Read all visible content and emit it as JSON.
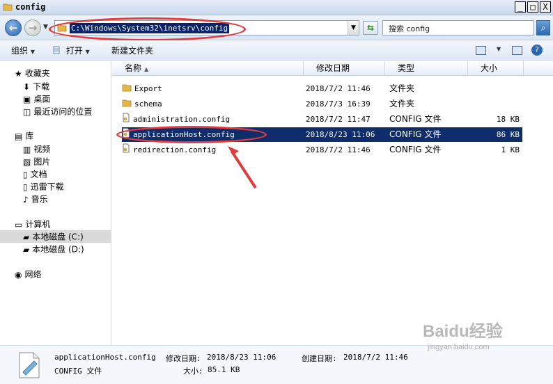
{
  "window": {
    "title": "config",
    "buttons": [
      "_",
      "□",
      "X"
    ]
  },
  "address_bar": {
    "path": "C:\\Windows\\System32\\inetsrv\\config",
    "search_placeholder": "搜索 config"
  },
  "toolbar": {
    "organize": "组织",
    "open": "打开",
    "new_folder": "新建文件夹"
  },
  "sidebar": {
    "favorites": "收藏夹",
    "favorites_items": [
      "下载",
      "桌面",
      "最近访问的位置"
    ],
    "libraries": "库",
    "library_items": [
      "视频",
      "图片",
      "文档",
      "迅雷下载",
      "音乐"
    ],
    "computer": "计算机",
    "computer_items": [
      "本地磁盘 (C:)",
      "本地磁盘 (D:)"
    ],
    "network": "网络"
  },
  "table": {
    "headers": [
      "名称",
      "修改日期",
      "类型",
      "大小"
    ],
    "rows": [
      {
        "name": "Export",
        "date": "2018/7/2 11:46",
        "type": "文件夹",
        "size": ""
      },
      {
        "name": "schema",
        "date": "2018/7/3 16:39",
        "type": "文件夹",
        "size": ""
      },
      {
        "name": "administration.config",
        "date": "2018/7/2 11:47",
        "type": "CONFIG 文件",
        "size": "18 KB"
      },
      {
        "name": "applicationHost.config",
        "date": "2018/8/23 11:06",
        "type": "CONFIG 文件",
        "size": "86 KB"
      },
      {
        "name": "redirection.config",
        "date": "2018/7/2 11:46",
        "type": "CONFIG 文件",
        "size": "1 KB"
      }
    ]
  },
  "details": {
    "filename": "applicationHost.config",
    "modified_label": "修改日期:",
    "modified_value": "2018/8/23 11:06",
    "created_label": "创建日期:",
    "created_value": "2018/7/2 11:46",
    "type": "CONFIG 文件",
    "size_label": "大小:",
    "size_value": "85.1 KB"
  },
  "watermark": {
    "brand": "Baidu经验",
    "url": "jingyan.baidu.com"
  },
  "colors": {
    "selection": "#0f2d6b",
    "annotation": "#e33b3b",
    "accent": "#2d63aa"
  }
}
